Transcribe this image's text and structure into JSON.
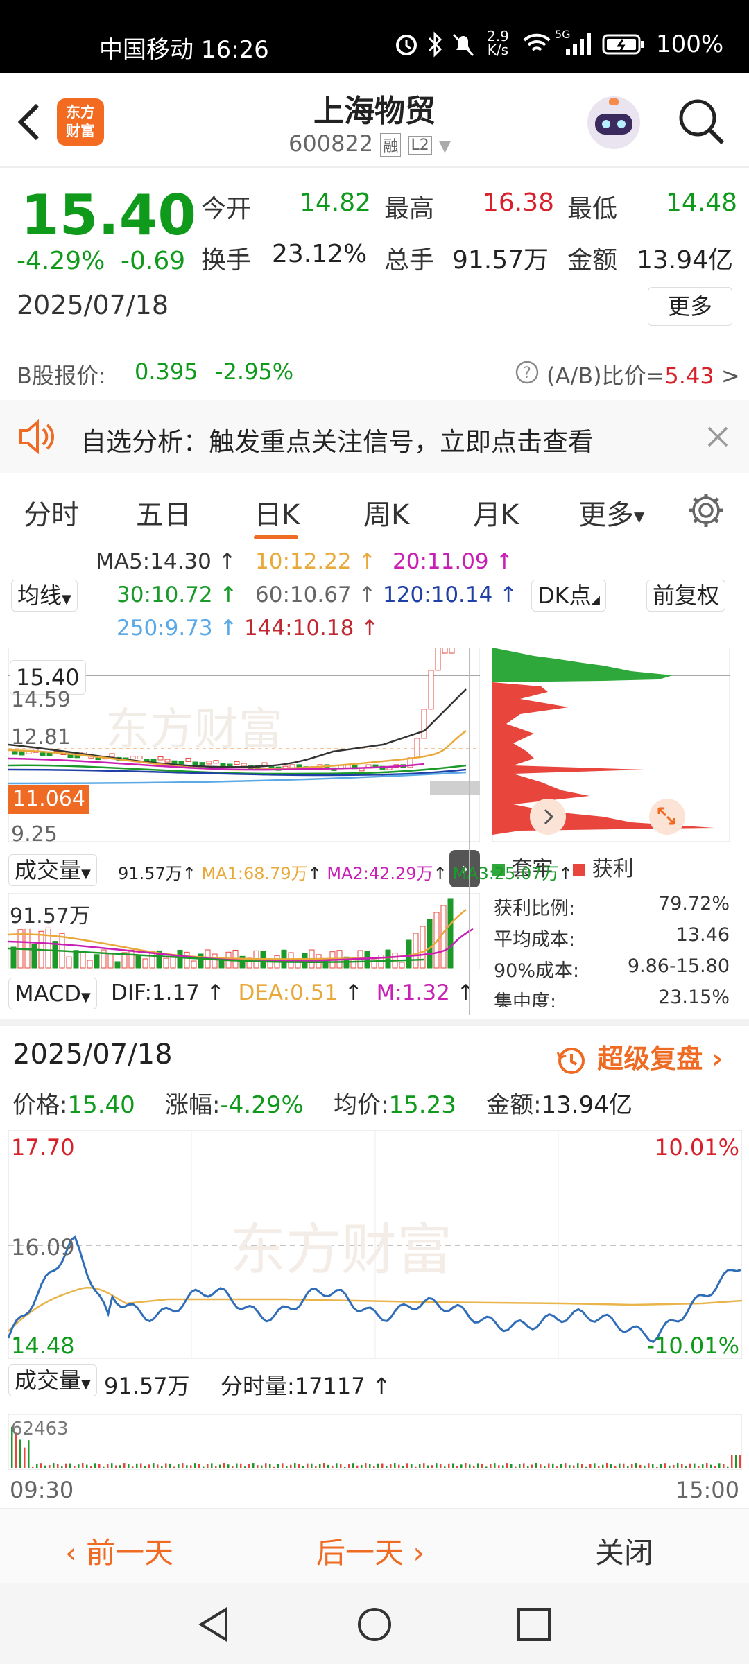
{
  "status_bar": {
    "carrier_time": "中国移动 16:26",
    "net_speed_top": "2.9",
    "net_speed_bottom": "K/s",
    "signal_label": "5G",
    "battery": "100%"
  },
  "header": {
    "logo_line1": "东方",
    "logo_line2": "财富",
    "title": "上海物贸",
    "code": "600822",
    "badge_margin": "融",
    "badge_level": "L2"
  },
  "quote": {
    "price": "15.40",
    "change_pct": "-4.29%",
    "change": "-0.69",
    "date": "2025/07/18",
    "open_label": "今开",
    "open": "14.82",
    "high_label": "最高",
    "high": "16.38",
    "low_label": "最低",
    "low": "14.48",
    "turnover_label": "换手",
    "turnover": "23.12%",
    "volume_label": "总手",
    "volume": "91.57万",
    "amount_label": "金额",
    "amount": "13.94亿",
    "more_button": "更多"
  },
  "b_share": {
    "label": "B股报价:",
    "price": "0.395",
    "change_pct": "-2.95%",
    "ratio_label": "(A/B)比价=",
    "ratio": "5.43",
    "arrow": ">"
  },
  "banner": {
    "text": "自选分析：触发重点关注信号，立即点击查看"
  },
  "tabs": [
    {
      "label": "分时"
    },
    {
      "label": "五日"
    },
    {
      "label": "日K"
    },
    {
      "label": "周K"
    },
    {
      "label": "月K"
    },
    {
      "label": "更多"
    }
  ],
  "ma": {
    "ma5": "MA5:14.30",
    "ma10": "10:12.22",
    "ma20": "20:11.09",
    "ma30": "30:10.72",
    "ma60": "60:10.67",
    "ma120": "120:10.14",
    "ma250": "250:9.73",
    "ma144": "144:10.18",
    "selector": "均线",
    "dk": "DK点",
    "adjust": "前复权",
    "colors": {
      "ma5": "#333333",
      "ma10": "#e9a93a",
      "ma20": "#c81fb4",
      "ma30": "#1b9a2a",
      "ma60": "#666666",
      "ma120": "#2140a6",
      "ma250": "#5aa9e6",
      "ma144": "#c0282f"
    }
  },
  "kchart": {
    "price_tag": "15.40",
    "y_label_1": "14.59",
    "y_label_2": "12.81",
    "avg_tag": "11.064",
    "y_label_3": "9.25",
    "watermark": "东方财富"
  },
  "chip_dist": {
    "legend_trapped": "套牢",
    "legend_profit": "获利",
    "rows": [
      {
        "label": "获利比例:",
        "value": "79.72%"
      },
      {
        "label": "平均成本:",
        "value": "13.46"
      },
      {
        "label": "90%成本:",
        "value": "9.86-15.80"
      },
      {
        "label": "集中度:",
        "value": "23.15%"
      }
    ]
  },
  "volume_indicator": {
    "selector": "成交量",
    "val": "91.57万",
    "ma1": "MA1:68.79万",
    "ma2": "MA2:42.29万",
    "ma3": "MA3:25.07万",
    "top_label": "91.57万"
  },
  "macd": {
    "selector": "MACD",
    "dif": "DIF:1.17",
    "dea": "DEA:0.51",
    "m": "M:1.32"
  },
  "day_detail": {
    "date": "2025/07/18",
    "replay": "超级复盘",
    "price_label": "价格:",
    "price": "15.40",
    "chg_label": "涨幅:",
    "chg": "-4.29%",
    "avg_label": "均价:",
    "avg": "15.23",
    "amount_label": "金额:",
    "amount": "13.94亿",
    "y_top": "17.70",
    "y_mid": "16.09",
    "y_bot": "14.48",
    "pct_top": "10.01%",
    "pct_bot": "-10.01%",
    "vol_selector": "成交量",
    "vol_total": "91.57万",
    "vol_tick": "分时量:17117",
    "vol_max": "62463",
    "time_start": "09:30",
    "time_end": "15:00",
    "watermark": "东方财富"
  },
  "bottom_bar": {
    "prev": "前一天",
    "next": "后一天",
    "close": "关闭"
  }
}
